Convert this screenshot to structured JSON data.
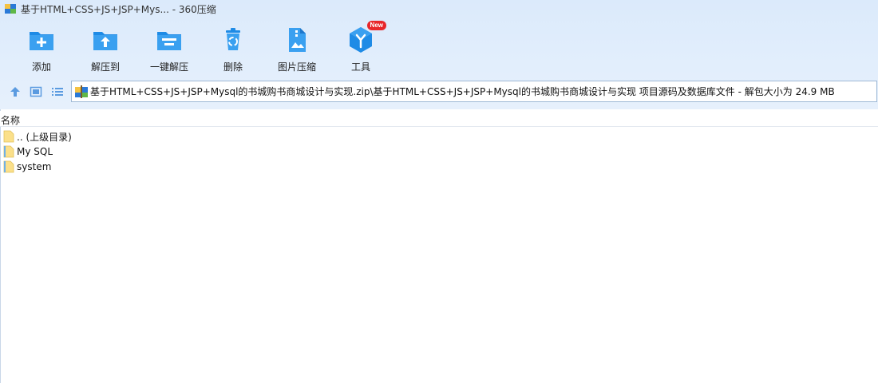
{
  "window": {
    "title": "基于HTML+CSS+JS+JSP+Mys... - 360压缩"
  },
  "toolbar": {
    "items": [
      {
        "label": "添加",
        "icon": "add-folder-icon"
      },
      {
        "label": "解压到",
        "icon": "extract-to-icon"
      },
      {
        "label": "一键解压",
        "icon": "one-click-extract-icon"
      },
      {
        "label": "删除",
        "icon": "recycle-bin-icon"
      },
      {
        "label": "图片压缩",
        "icon": "image-compress-icon"
      },
      {
        "label": "工具",
        "icon": "tools-icon",
        "badge": "New"
      }
    ]
  },
  "address": {
    "path": "基于HTML+CSS+JS+JSP+Mysql的书城购书商城设计与实现.zip\\基于HTML+CSS+JS+JSP+Mysql的书城购书商城设计与实现 项目源码及数据库文件 - 解包大小为 24.9 MB"
  },
  "list": {
    "column_name": "名称",
    "rows": [
      {
        "name": ".. (上级目录)",
        "icon": "folder-icon"
      },
      {
        "name": "My SQL",
        "icon": "archive-folder-icon"
      },
      {
        "name": "system",
        "icon": "archive-folder-icon"
      }
    ]
  },
  "colors": {
    "accent": "#1e8be6",
    "badge": "#e8262a",
    "chrome": "#dbeafb"
  }
}
